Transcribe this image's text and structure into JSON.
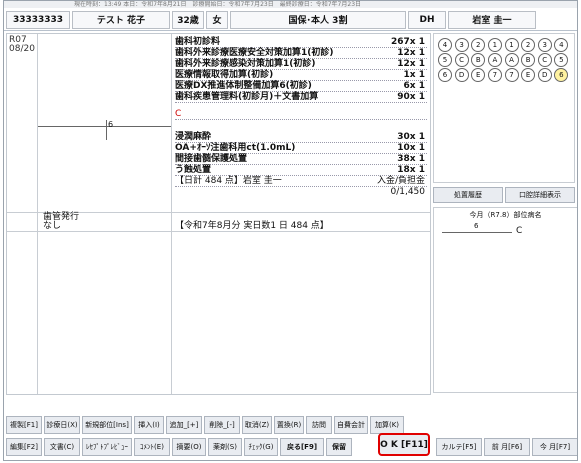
{
  "top_strip": "現在時刻：13:49 本日：令和7年8月21日　診療開始日：令和7年7月23日　最終診療日：令和7年7月23日",
  "header": {
    "patient_id": "33333333",
    "patient_name": "テスト 花子",
    "age": "32歳",
    "sex": "女",
    "insurance": "国保･本人 3割",
    "doctor_code": "DH",
    "doctor_name": "岩室 圭一"
  },
  "visit": {
    "date": "R07\n08/20",
    "tooth_marker": "6",
    "lines": [
      {
        "name": "歯科初診料",
        "qty": "267x 1"
      },
      {
        "name": "歯科外来診療医療安全対策加算1(初診)",
        "qty": "12x 1"
      },
      {
        "name": "歯科外来診療感染対策加算1(初診)",
        "qty": "12x 1"
      },
      {
        "name": "医療情報取得加算(初診)",
        "qty": "1x 1"
      },
      {
        "name": "医療DX推進体制整備加算6(初診)",
        "qty": "6x 1"
      },
      {
        "name": "歯科疾患管理料(初診月)＋文書加算",
        "qty": "90x 1"
      },
      {
        "name": "C",
        "qty": ""
      },
      {
        "name": "浸潤麻酔",
        "qty": "30x 1"
      },
      {
        "name": "OA+ｵｰｿ注歯科用ct(1.0mL)",
        "qty": "10x 1"
      },
      {
        "name": "間接歯髄保護処置",
        "qty": "38x 1"
      },
      {
        "name": "う蝕処置",
        "qty": "18x 1"
      }
    ],
    "daily_total": "【日計 484 点】岩室 圭一",
    "payment_label": "入金/負担金",
    "payment_value": "0/1,450"
  },
  "summary": {
    "left": "歯管発行\nなし",
    "right": "【令和7年8月分 実日数1 日 484 点】"
  },
  "right_panel": {
    "tab1": "処置履歴",
    "tab2": "口腔詳細表示",
    "month_label": "今月（R7.8）部位病名",
    "chart_tooth": "6",
    "chart_label": "C"
  },
  "buttons_row1": [
    "複製[F1]",
    "診療日(X)",
    "新規部位[Ins]",
    "挿入(I)",
    "追加_[+]",
    "削除_[-]",
    "取消(Z)",
    "置換(R)",
    "訪問",
    "自費会計",
    "加算(K)"
  ],
  "buttons_row2": [
    "編集[F2]",
    "文書(C)",
    "ﾚｾﾌﾟﾄﾌﾟﾚﾋﾞｭｰ",
    "ｺﾒﾝﾄ(E)",
    "摘要(O)",
    "薬剤(S)",
    "ﾁｪｯｸ(G)",
    "戻る[F9]",
    "保留"
  ],
  "ok_button": "O K [F11]",
  "kbar": [
    "カルテ[F5]",
    "前 月[F6]",
    "今 月[F7]"
  ]
}
